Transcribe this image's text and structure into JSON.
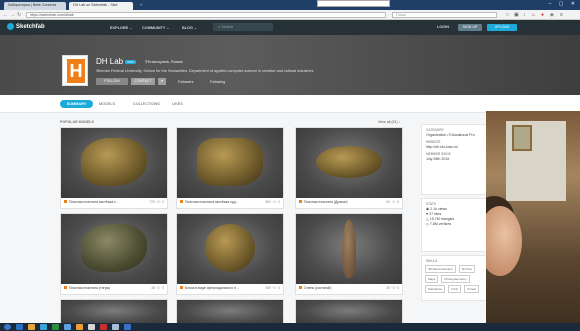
{
  "browser": {
    "tabs": [
      {
        "label": "Лаборатория | Belle Contents",
        "active": false
      },
      {
        "label": "DH Lab on Sketchfab - Sket",
        "active": true
      },
      {
        "label": "+",
        "active": false
      }
    ],
    "window_controls": "– ▢ ✕",
    "url": "https://sketchfab.com/dhlab",
    "search_placeholder": "Поиск"
  },
  "header": {
    "logo": "Sketchfab",
    "menu": [
      "EXPLORE ⌄",
      "COMMUNITY ⌄",
      "BLOG ⌄"
    ],
    "search_placeholder": "Search",
    "login": "LOGIN",
    "signup": "SIGN UP",
    "upload": "UPLOAD"
  },
  "profile": {
    "name": "DH Lab",
    "badge": "PRO",
    "location": "Krasnoyarsk, Russia",
    "description": "Siberian Federal University, School for the Humanities, Department of applied computer science in creative and cultural industries",
    "follow": "FOLLOW",
    "contact": "CONTACT",
    "more": "▾",
    "followers": "Followers",
    "following": "Following"
  },
  "subtabs": {
    "summary": "SUMMARY",
    "models": "MODELS",
    "collections": "COLLECTIONS",
    "likes": "LIKES"
  },
  "content": {
    "popular": "POPULAR MODELS",
    "view_all": "View all (51) ›",
    "cards": [
      {
        "title": "Поясная пластина застёжка с...",
        "meta": "723 · 0 · 0"
      },
      {
        "title": "Поясная пластина застёжка худ...",
        "meta": "654 · 0 · 0"
      },
      {
        "title": "Поясная пластина (Дракон)",
        "meta": "54 · 0 · 0"
      },
      {
        "title": "Поясная пластина (тигры)",
        "meta": "46 · 0 · 0"
      },
      {
        "title": "Бляха в виде сфероидального н...",
        "meta": "309 · 0 · 0"
      },
      {
        "title": "Олень (костяной)",
        "meta": "35 · 0 · 0"
      }
    ]
  },
  "sidebar": {
    "category_h": "CATEGORY",
    "category_v": "Organization / Educational Pro",
    "website_h": "WEBSITE",
    "website_v": "http://dh.sfu-kras.ru/",
    "member_h": "MEMBER SINCE",
    "member_v": "July 28th 2016",
    "stats_h": "STATS",
    "stats": [
      "2.1k views",
      "37 likes",
      "15.7M triangles",
      "7.8M vertices"
    ],
    "skills_h": "SKILLS",
    "skills": [
      "3D Reconstruction",
      "3D Sca",
      "Maya",
      "Photogrammetry",
      "Substance",
      "Unity",
      "Unreal"
    ]
  }
}
